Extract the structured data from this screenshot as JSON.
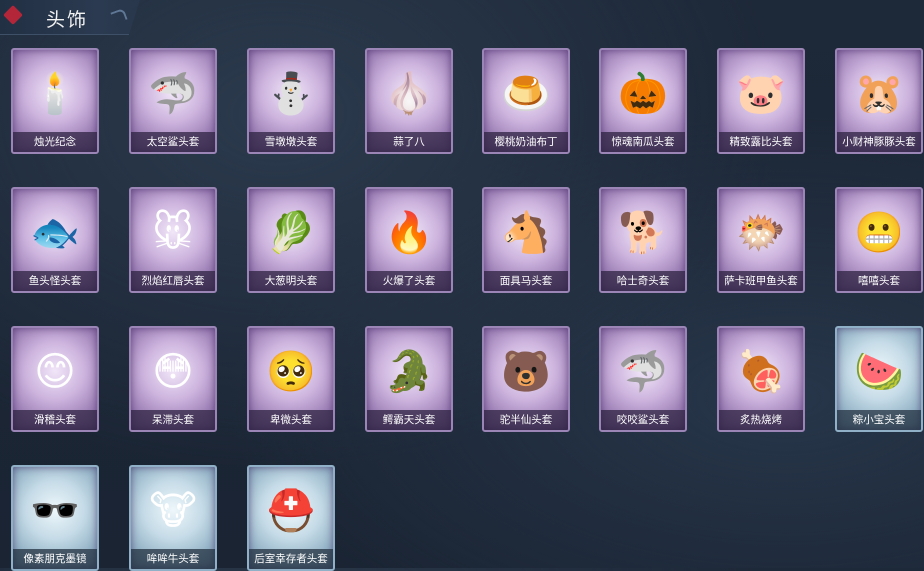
{
  "header": {
    "title": "头饰"
  },
  "items": [
    {
      "name": "烛光纪念",
      "icon": "🕯️",
      "theme": "purple"
    },
    {
      "name": "太空鲨头套",
      "icon": "🦈",
      "theme": "purple"
    },
    {
      "name": "雪墩墩头套",
      "icon": "⛄",
      "theme": "purple"
    },
    {
      "name": "蒜了八",
      "icon": "🧄",
      "theme": "purple"
    },
    {
      "name": "樱桃奶油布丁",
      "icon": "🍮",
      "theme": "purple"
    },
    {
      "name": "惊魂南瓜头套",
      "icon": "🎃",
      "theme": "purple"
    },
    {
      "name": "精致露比头套",
      "icon": "🐷",
      "theme": "purple"
    },
    {
      "name": "小财神豚豚头套",
      "icon": "🐹",
      "theme": "purple"
    },
    {
      "name": "鱼头怪头套",
      "icon": "🐟",
      "theme": "purple"
    },
    {
      "name": "烈焰红唇头套",
      "icon": "🐭",
      "theme": "purple"
    },
    {
      "name": "大葱明头套",
      "icon": "🥬",
      "theme": "purple"
    },
    {
      "name": "火爆了头套",
      "icon": "🔥",
      "theme": "purple"
    },
    {
      "name": "面具马头套",
      "icon": "🐴",
      "theme": "purple"
    },
    {
      "name": "哈士奇头套",
      "icon": "🐕",
      "theme": "purple"
    },
    {
      "name": "萨卡班甲鱼头套",
      "icon": "🐡",
      "theme": "purple"
    },
    {
      "name": "嘻嘻头套",
      "icon": "😬",
      "theme": "purple"
    },
    {
      "name": "滑稽头套",
      "icon": "😊",
      "theme": "purple"
    },
    {
      "name": "呆滞头套",
      "icon": "😳",
      "theme": "purple"
    },
    {
      "name": "卑微头套",
      "icon": "🥺",
      "theme": "purple"
    },
    {
      "name": "鳄霸天头套",
      "icon": "🐊",
      "theme": "purple"
    },
    {
      "name": "驼半仙头套",
      "icon": "🐻",
      "theme": "purple"
    },
    {
      "name": "咬咬鲨头套",
      "icon": "🦈",
      "theme": "purple"
    },
    {
      "name": "炙热烧烤",
      "icon": "🍖",
      "theme": "purple"
    },
    {
      "name": "粽小宝头套",
      "icon": "🍉",
      "theme": "blue"
    },
    {
      "name": "像素朋克墨镜",
      "icon": "🕶️",
      "theme": "blue"
    },
    {
      "name": "哞哞牛头套",
      "icon": "🐮",
      "theme": "blue"
    },
    {
      "name": "后室幸存者头套",
      "icon": "⛑️",
      "theme": "blue"
    }
  ]
}
